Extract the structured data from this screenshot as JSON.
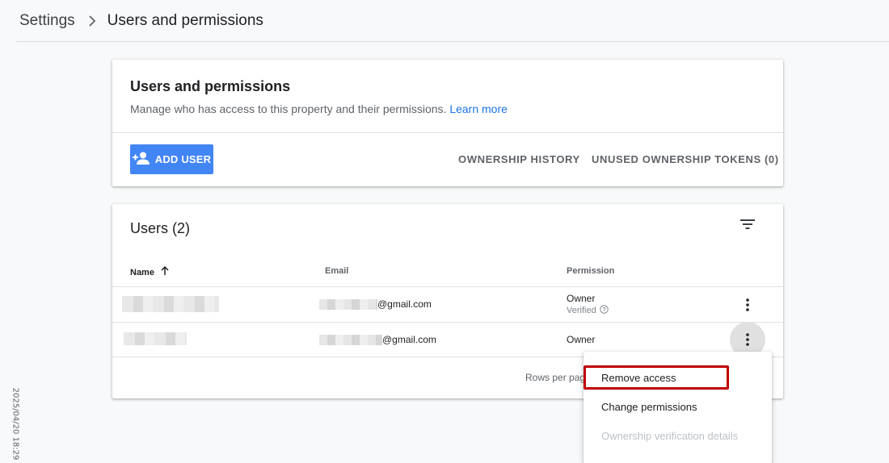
{
  "breadcrumb": {
    "root": "Settings",
    "current": "Users and permissions"
  },
  "header_card": {
    "title": "Users and permissions",
    "description": "Manage who has access to this property and their permissions.",
    "learn_more": "Learn more",
    "add_user_label": "ADD USER",
    "ownership_history_label": "OWNERSHIP HISTORY",
    "unused_tokens_label": "UNUSED OWNERSHIP TOKENS (0)"
  },
  "users_card": {
    "title": "Users (2)",
    "columns": {
      "name": "Name",
      "email": "Email",
      "permission": "Permission"
    },
    "rows": [
      {
        "email_suffix": "@gmail.com",
        "permission": "Owner",
        "status": "Verified"
      },
      {
        "email_suffix": "@gmail.com",
        "permission": "Owner"
      }
    ],
    "rows_per_page": "Rows per pag"
  },
  "context_menu": {
    "items": [
      "Remove access",
      "Change permissions",
      "Ownership verification details"
    ]
  },
  "timestamp": "2025/04/20 18:29",
  "colors": {
    "accent": "#4285f4",
    "link": "#1a73e8",
    "highlight_border": "#c00000"
  }
}
